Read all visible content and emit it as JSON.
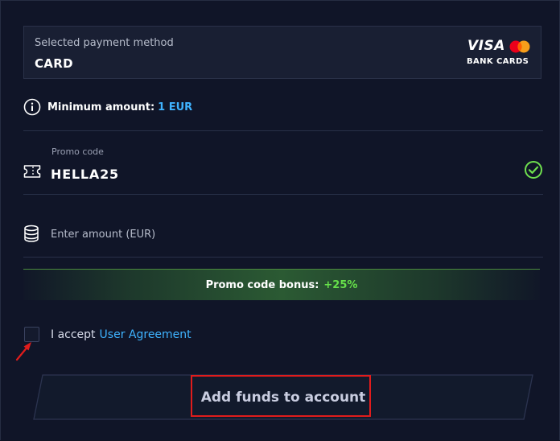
{
  "payment_method": {
    "label": "Selected payment method",
    "value": "CARD",
    "brand_visa": "VISA",
    "brand_caption": "BANK CARDS"
  },
  "minimum": {
    "label": "Minimum amount:",
    "value": "1 EUR"
  },
  "promo": {
    "label": "Promo code",
    "value": "HELLA25",
    "status": "valid"
  },
  "amount": {
    "placeholder": "Enter amount (EUR)",
    "value": ""
  },
  "bonus": {
    "label": "Promo code bonus:",
    "value": "+25%"
  },
  "agreement": {
    "prefix": "I accept",
    "link_text": "User Agreement",
    "checked": false
  },
  "submit": {
    "label": "Add funds to account"
  },
  "colors": {
    "accent_link": "#3fb3ff",
    "bonus_green": "#66e04a",
    "highlight_red": "#e01c1c",
    "check_green": "#6fe04e"
  }
}
